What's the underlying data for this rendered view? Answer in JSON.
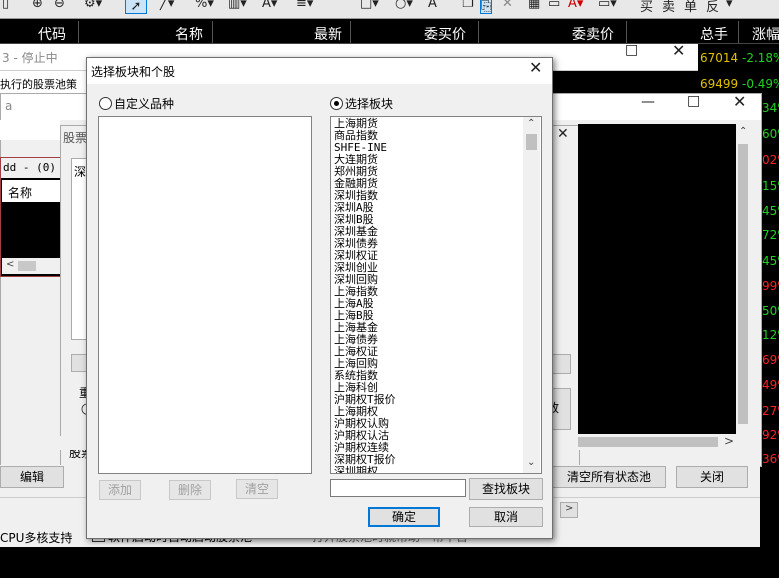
{
  "toolbar": {
    "icons": [
      "lock-icon",
      "zoom-in-icon",
      "zoom-out-icon",
      "gear-icon",
      "pointer-icon",
      "line-icon",
      "percent-icon",
      "ruler-icon",
      "text-color-icon",
      "list-icon",
      "rectangle-icon",
      "circle-icon",
      "text-icon",
      "copy-icon",
      "paste-icon",
      "close-icon",
      "grid-icon",
      "font-color-icon",
      "layers-icon"
    ],
    "right_labels": [
      "买",
      "卖",
      "单",
      "反"
    ],
    "glyph_a": "A"
  },
  "quote_header": {
    "columns": [
      "代码",
      "名称",
      "最新",
      "委买价",
      "委卖价",
      "总手",
      "涨幅"
    ],
    "rows_partial": [
      {
        "total": "67014",
        "change": "-2.18%"
      },
      {
        "total": "69499",
        "change": "-0.49%"
      }
    ],
    "side_changes": [
      "34%",
      "60%",
      "02%",
      "15%",
      "45%",
      "72%",
      "45%",
      "99%",
      "50%",
      "12%",
      "69%",
      "49%",
      "27%",
      "92%",
      "36%"
    ]
  },
  "bg_windows": {
    "win1_title": "3 - 停止中",
    "win1_text": "执行的股票池策略",
    "win2_title": "a",
    "win3_title": "股票",
    "dd_title": "dd - (0)",
    "dd_header": "名称",
    "inner_text": "深",
    "label_zhong": "重",
    "label_gupiao": "股票",
    "label_zhi": "致",
    "edit_button": "编辑",
    "clear_all_button": "清空所有状态池",
    "close_button": "关闭",
    "cpu_checkbox": "CPU多核支持",
    "startup_checkbox": "软件启动时自动启动股票池",
    "hint_text": "打开股票池时就帮助一帮平台"
  },
  "dialog": {
    "title": "选择板块和个股",
    "custom_radio": "自定义品种",
    "block_radio": "选择板块",
    "selected_radio": "block",
    "block_items": [
      "上海期货",
      "商品指数",
      "SHFE-INE",
      "大连期货",
      "郑州期货",
      "金融期货",
      "深圳指数",
      "深圳A股",
      "深圳B股",
      "深圳基金",
      "深圳债券",
      "深圳权证",
      "深圳创业",
      "深圳回购",
      "上海指数",
      "上海A股",
      "上海B股",
      "上海基金",
      "上海债券",
      "上海权证",
      "上海回购",
      "系统指数",
      "上海科创",
      "沪期权T报价",
      "上海期权",
      "沪期权认购",
      "沪期权认沽",
      "沪期权连续",
      "深期权T报价",
      "深圳期权"
    ],
    "add_button": "添加",
    "delete_button": "删除",
    "clear_button": "清空",
    "search_value": "",
    "search_button": "查找板块",
    "ok_button": "确定",
    "cancel_button": "取消"
  },
  "colors": {
    "up": "#ff2020",
    "down": "#20d020",
    "yellow": "#e0c000",
    "select_blue": "#0078d7"
  }
}
